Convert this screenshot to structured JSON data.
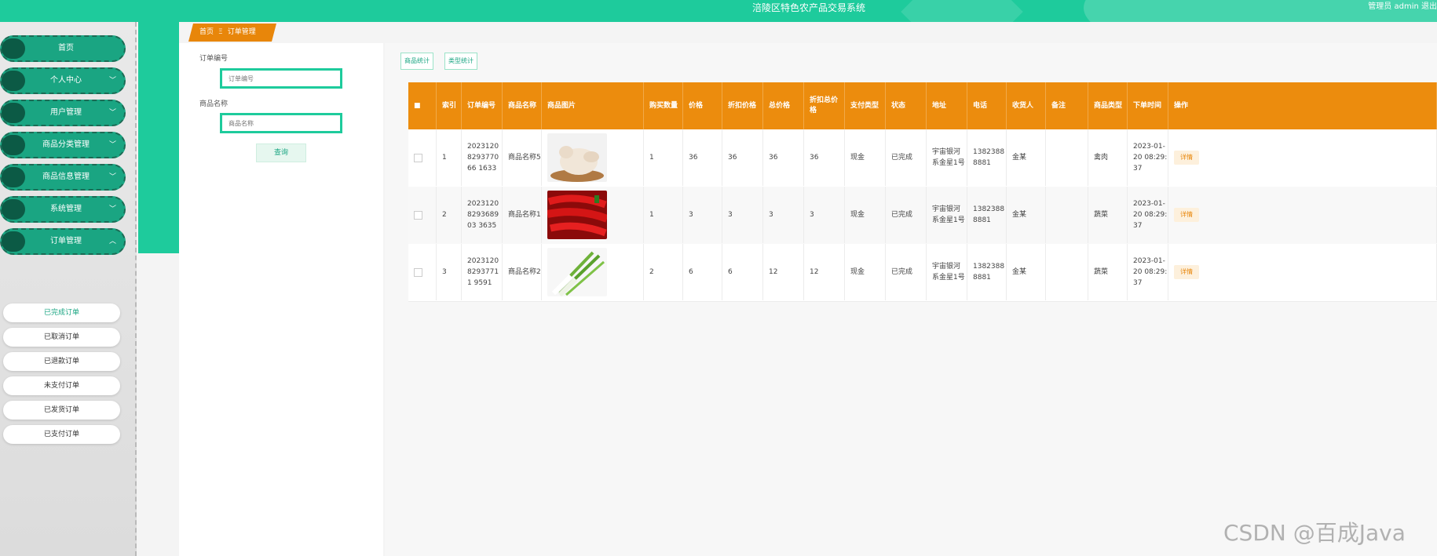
{
  "header": {
    "title": "涪陵区特色农产品交易系统",
    "user": "管理员 admin  退出"
  },
  "sidebar": {
    "menus": [
      {
        "label": "首页",
        "chevron": ""
      },
      {
        "label": "个人中心",
        "chevron": "﹀"
      },
      {
        "label": "用户管理",
        "chevron": "﹀"
      },
      {
        "label": "商品分类管理",
        "chevron": "﹀"
      },
      {
        "label": "商品信息管理",
        "chevron": "﹀"
      },
      {
        "label": "系统管理",
        "chevron": "﹀"
      },
      {
        "label": "订单管理",
        "chevron": "︿"
      }
    ],
    "submenu": [
      "已完成订单",
      "已取消订单",
      "已退款订单",
      "未支付订单",
      "已发货订单",
      "已支付订单"
    ]
  },
  "breadcrumb": {
    "home": "首页",
    "separator": "Ξ",
    "current": "订单管理"
  },
  "search": {
    "order_label": "订单编号",
    "order_placeholder": "订单编号",
    "product_label": "商品名称",
    "product_placeholder": "商品名称",
    "button": "查询"
  },
  "toolbar": {
    "btn1": "商品统计",
    "btn2": "类型统计"
  },
  "table": {
    "headers": [
      "■",
      "索引",
      "订单编号",
      "商品名称",
      "商品图片",
      "购买数量",
      "价格",
      "折扣价格",
      "总价格",
      "折扣总价格",
      "支付类型",
      "状态",
      "地址",
      "电话",
      "收货人",
      "备注",
      "商品类型",
      "下单时间",
      "操作"
    ],
    "rows": [
      {
        "idx": "1",
        "order_no": "2023120829377066 1633",
        "name": "商品名称5",
        "img": "chicken-image",
        "qty": "1",
        "price": "36",
        "discount_price": "36",
        "total": "36",
        "discount_total": "36",
        "pay": "现金",
        "status": "已完成",
        "address": "宇宙银河系金星1号",
        "phone": "13823888881",
        "receiver": "金某",
        "remark": "",
        "type": "禽肉",
        "time": "2023-01-20 08:29:37",
        "action": "详情"
      },
      {
        "idx": "2",
        "order_no": "2023120829368903 3635",
        "name": "商品名称1",
        "img": "pepper-image",
        "qty": "1",
        "price": "3",
        "discount_price": "3",
        "total": "3",
        "discount_total": "3",
        "pay": "现金",
        "status": "已完成",
        "address": "宇宙银河系金星1号",
        "phone": "13823888881",
        "receiver": "金某",
        "remark": "",
        "type": "蔬菜",
        "time": "2023-01-20 08:29:37",
        "action": "详情"
      },
      {
        "idx": "3",
        "order_no": "202312082937711 9591",
        "name": "商品名称2",
        "img": "scallion-image",
        "qty": "2",
        "price": "6",
        "discount_price": "6",
        "total": "12",
        "discount_total": "12",
        "pay": "现金",
        "status": "已完成",
        "address": "宇宙银河系金星1号",
        "phone": "13823888881",
        "receiver": "金某",
        "remark": "",
        "type": "蔬菜",
        "time": "2023-01-20 08:29:37",
        "action": "详情"
      }
    ]
  },
  "watermark": "CSDN @百成Java"
}
